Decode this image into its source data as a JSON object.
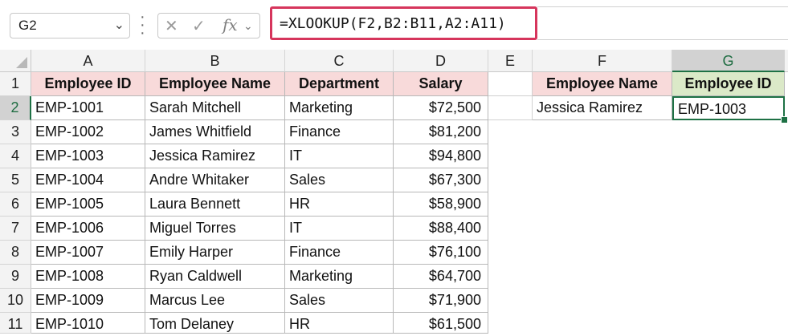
{
  "name_box": {
    "value": "G2"
  },
  "formula_bar": {
    "formula": "=XLOOKUP(F2,B2:B11,A2:A11)",
    "cancel_glyph": "✕",
    "enter_glyph": "✓",
    "fx_label": "fx"
  },
  "columns": [
    "A",
    "B",
    "C",
    "D",
    "E",
    "F",
    "G"
  ],
  "rows": [
    "1",
    "2",
    "3",
    "4",
    "5",
    "6",
    "7",
    "8",
    "9",
    "10",
    "11"
  ],
  "table": {
    "headers": [
      "Employee ID",
      "Employee Name",
      "Department",
      "Salary"
    ],
    "records": [
      [
        "EMP-1001",
        "Sarah Mitchell",
        "Marketing",
        "$72,500"
      ],
      [
        "EMP-1002",
        "James Whitfield",
        "Finance",
        "$81,200"
      ],
      [
        "EMP-1003",
        "Jessica Ramirez",
        "IT",
        "$94,800"
      ],
      [
        "EMP-1004",
        "Andre Whitaker",
        "Sales",
        "$67,300"
      ],
      [
        "EMP-1005",
        "Laura Bennett",
        "HR",
        "$58,900"
      ],
      [
        "EMP-1006",
        "Miguel Torres",
        "IT",
        "$88,400"
      ],
      [
        "EMP-1007",
        "Emily Harper",
        "Finance",
        "$76,100"
      ],
      [
        "EMP-1008",
        "Ryan Caldwell",
        "Marketing",
        "$64,700"
      ],
      [
        "EMP-1009",
        "Marcus Lee",
        "Sales",
        "$71,900"
      ],
      [
        "EMP-1010",
        "Tom Delaney",
        "HR",
        "$61,500"
      ]
    ]
  },
  "lookup": {
    "header_name": "Employee Name",
    "header_id": "Employee ID",
    "name_value": "Jessica Ramirez",
    "id_value": "EMP-1003"
  },
  "colors": {
    "accent_border": "#d6355c",
    "selection": "#1e7145",
    "header_pink": "#f8dada",
    "header_green": "#dbe9c8"
  }
}
